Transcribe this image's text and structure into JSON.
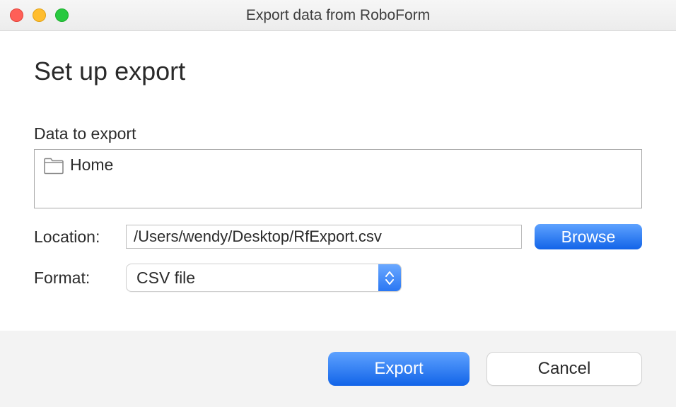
{
  "window": {
    "title": "Export data from RoboForm"
  },
  "main": {
    "heading": "Set up export",
    "data_section_label": "Data to export",
    "data_item": "Home",
    "location_label": "Location:",
    "location_value": "/Users/wendy/Desktop/RfExport.csv",
    "browse_label": "Browse",
    "format_label": "Format:",
    "format_value": "CSV file"
  },
  "footer": {
    "export_label": "Export",
    "cancel_label": "Cancel"
  }
}
